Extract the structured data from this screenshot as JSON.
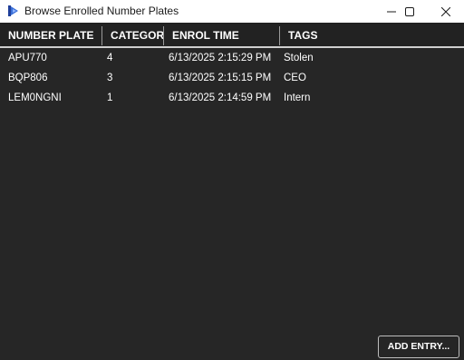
{
  "window": {
    "title": "Browse Enrolled Number Plates",
    "icon": "app-logo-icon",
    "controls": [
      "minimize-icon",
      "maximize-icon",
      "close-icon"
    ]
  },
  "table": {
    "columns": [
      "NUMBER PLATE",
      "CATEGORY",
      "ENROL TIME",
      "TAGS"
    ],
    "rows": [
      {
        "plate": "APU770",
        "category": "4",
        "enrol_time": "6/13/2025 2:15:29 PM",
        "tags": "Stolen"
      },
      {
        "plate": "BQP806",
        "category": "3",
        "enrol_time": "6/13/2025 2:15:15 PM",
        "tags": "CEO"
      },
      {
        "plate": "LEM0NGNI",
        "category": "1",
        "enrol_time": "6/13/2025 2:14:59 PM",
        "tags": "Intern"
      }
    ]
  },
  "footer": {
    "add_entry_label": "ADD ENTRY..."
  },
  "colors": {
    "background": "#262626",
    "titlebar": "#ffffff",
    "header_rule": "#cfcfcf",
    "icon_accent": "#3a6fd8"
  }
}
